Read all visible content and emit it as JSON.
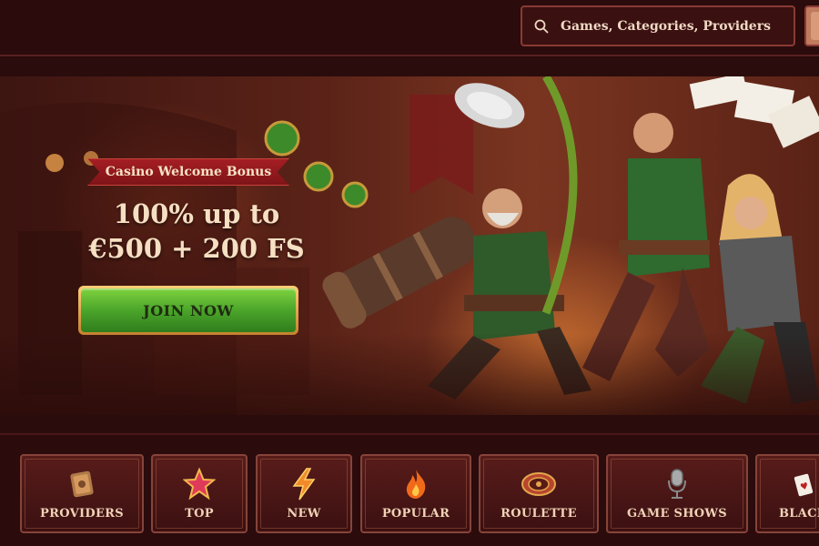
{
  "header": {
    "search_placeholder": "Games, Categories, Providers",
    "search_icon": "search-icon"
  },
  "hero": {
    "badge": "Casino Welcome Bonus",
    "line1": "100% up to",
    "line2": "€500 + 200 FS",
    "cta": "JOIN NOW"
  },
  "categories": [
    {
      "label": "PROVIDERS",
      "icon": "book-icon"
    },
    {
      "label": "TOP",
      "icon": "star-icon"
    },
    {
      "label": "NEW",
      "icon": "lightning-icon"
    },
    {
      "label": "POPULAR",
      "icon": "fire-icon"
    },
    {
      "label": "ROULETTE",
      "icon": "roulette-icon"
    },
    {
      "label": "GAME SHOWS",
      "icon": "microphone-icon"
    },
    {
      "label": "BLACK",
      "icon": "cards-icon"
    }
  ],
  "colors": {
    "background": "#2a0c0c",
    "accent_red": "#a41e24",
    "cta_green": "#4ba52a",
    "gold": "#e0a84a"
  }
}
